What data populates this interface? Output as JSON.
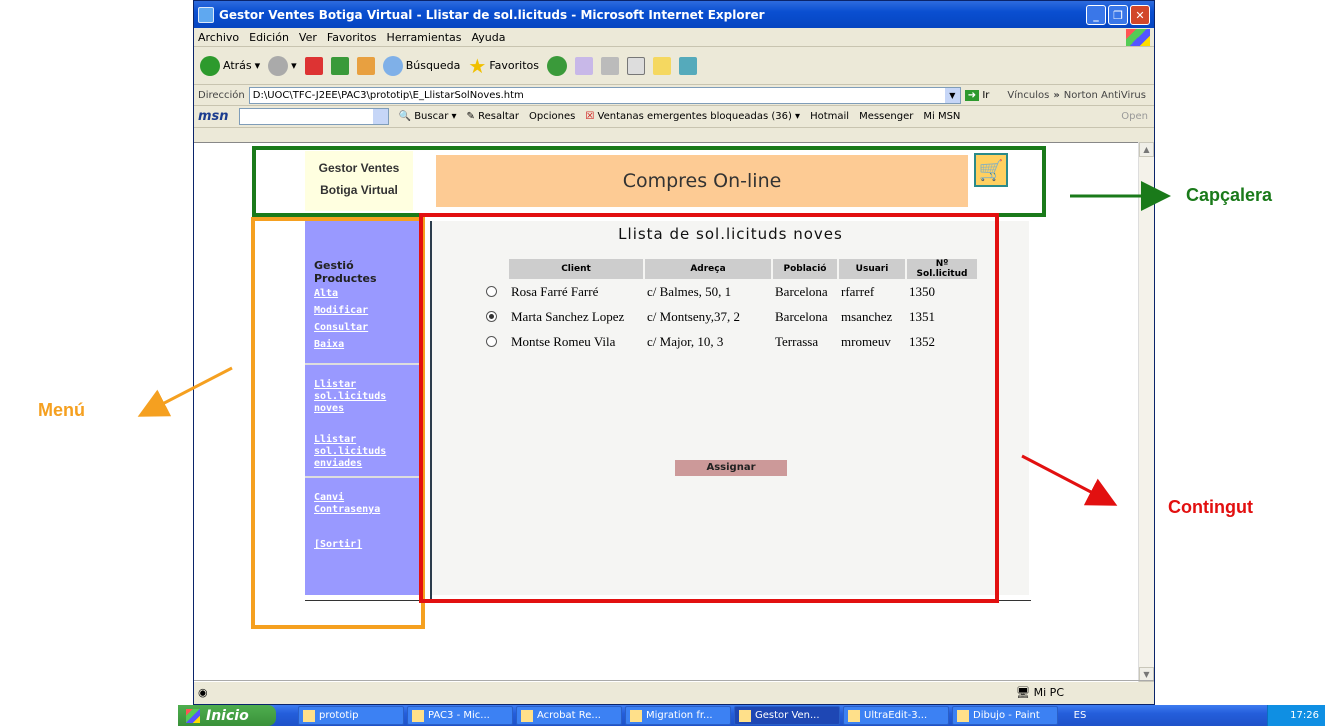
{
  "window": {
    "title": "Gestor Ventes Botiga Virtual - Llistar de sol.licituds - Microsoft Internet Explorer"
  },
  "menubar": [
    "Archivo",
    "Edición",
    "Ver",
    "Favoritos",
    "Herramientas",
    "Ayuda"
  ],
  "toolbar": {
    "back": "Atrás",
    "search": "Búsqueda",
    "favorites": "Favoritos"
  },
  "address": {
    "label": "Dirección",
    "url": "D:\\UOC\\TFC-J2EE\\PAC3\\prototip\\E_LlistarSolNoves.htm",
    "go": "Ir",
    "links": "Vínculos",
    "norton": "Norton AntiVirus"
  },
  "msn": {
    "logo": "msn",
    "buscar": "Buscar",
    "resaltar": "Resaltar",
    "opciones": "Opciones",
    "popups": "Ventanas emergentes bloqueadas (36)",
    "hotmail": "Hotmail",
    "messenger": "Messenger",
    "mimsn": "Mi MSN",
    "open": "Open"
  },
  "header": {
    "brand_line1": "Gestor Ventes",
    "brand_line2": "Botiga Virtual",
    "banner": "Compres On-line"
  },
  "menu": {
    "section": "Gestió Productes",
    "items": [
      "Alta",
      "Modificar",
      "Consultar",
      "Baixa"
    ],
    "item_llistar_noves": "Llistar sol.licituds noves",
    "item_llistar_enviades": "Llistar sol.licituds enviades",
    "item_canvi": "Canvi Contrasenya",
    "item_sortir": "[Sortir]"
  },
  "content": {
    "title": "Llista de sol.licituds noves",
    "columns": [
      "Client",
      "Adreça",
      "Població",
      "Usuari",
      "Nº Sol.licitud"
    ],
    "rows": [
      {
        "client": "Rosa Farré Farré",
        "adreca": "c/ Balmes, 50, 1",
        "poblacio": "Barcelona",
        "usuari": "rfarref",
        "num": "1350",
        "selected": false
      },
      {
        "client": "Marta Sanchez Lopez",
        "adreca": "c/ Montseny,37, 2",
        "poblacio": "Barcelona",
        "usuari": "msanchez",
        "num": "1351",
        "selected": true
      },
      {
        "client": "Montse Romeu Vila",
        "adreca": "c/ Major, 10, 3",
        "poblacio": "Terrassa",
        "usuari": "mromeuv",
        "num": "1352",
        "selected": false
      }
    ],
    "assign_button": "Assignar"
  },
  "statusbar": {
    "zone": "Mi PC"
  },
  "taskbar": {
    "start": "Inicio",
    "tasks": [
      "prototip",
      "PAC3 - Mic...",
      "Acrobat Re...",
      "Migration fr...",
      "Gestor Ven...",
      "UltraEdit-3...",
      "Dibujo - Paint"
    ],
    "active": 4,
    "lang": "ES",
    "clock": "17:26"
  },
  "annotations": {
    "header": "Capçalera",
    "menu": "Menú",
    "content": "Contingut"
  },
  "colors": {
    "header_box": "#1a7a1a",
    "menu_box": "#f5a020",
    "content_box": "#e21010",
    "menu_bg": "#9999ff",
    "banner_bg": "#fdcb94"
  }
}
